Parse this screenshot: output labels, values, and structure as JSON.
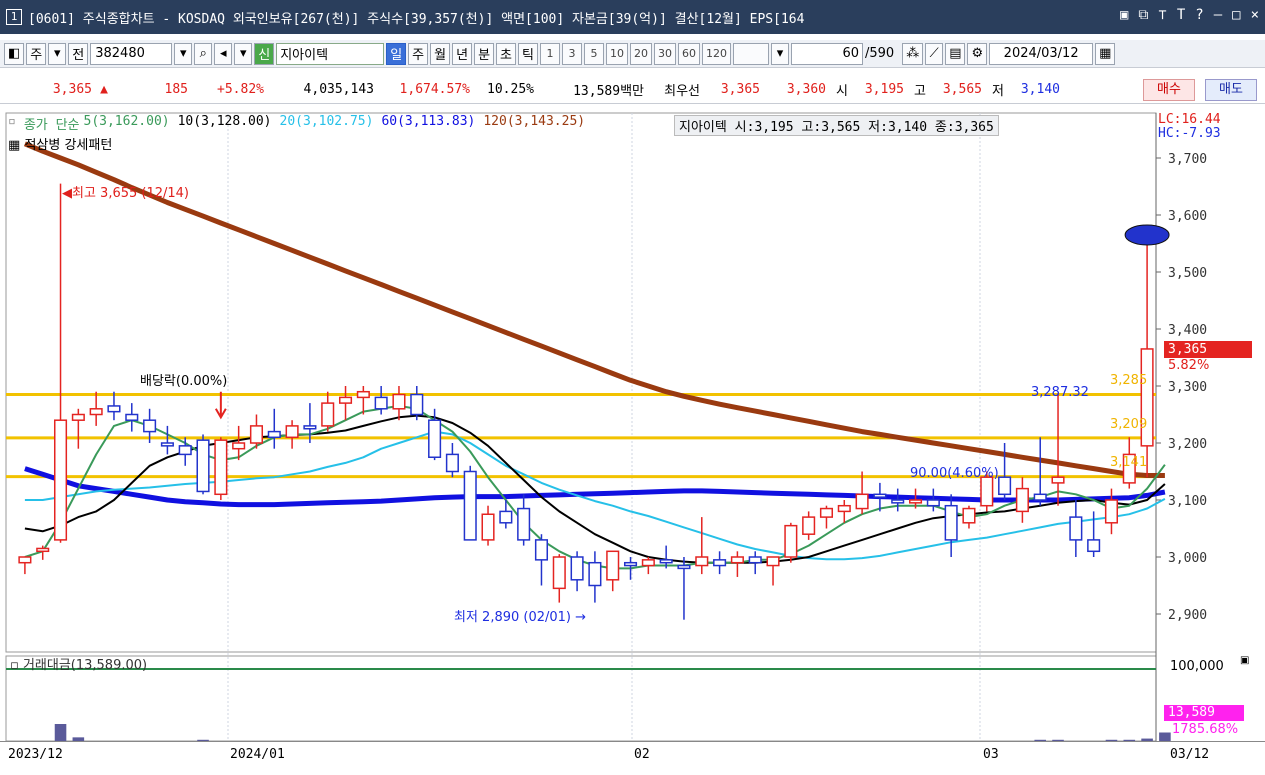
{
  "window": {
    "number": "1",
    "title": "[0601] 주식종합차트 - KOSDAQ 외국인보유[267(천)] 주식수[39,357(천)] 액면[100] 자본금[39(억)] 결산[12월] EPS[164",
    "icons": [
      "window-icon",
      "popout-icon",
      "pin-icon",
      "font-icon",
      "help-icon",
      "minimize-icon",
      "maximize-icon",
      "close-icon"
    ]
  },
  "toolbar": {
    "mode": "주",
    "prefix": "전",
    "code": "382480",
    "name_badge": "신",
    "name": "지아이텍",
    "periods": [
      "일",
      "주",
      "월",
      "년",
      "분",
      "초",
      "틱"
    ],
    "selected_period": "일",
    "intervals": [
      "1",
      "3",
      "5",
      "10",
      "20",
      "30",
      "60",
      "120"
    ],
    "count": "60",
    "total": "/590",
    "date": "2024/03/12"
  },
  "info": {
    "price": "3,365",
    "change_arrow": "▲",
    "change": "185",
    "change_pct": "+5.82%",
    "volume": "4,035,143",
    "volume_ratio": "1,674.57%",
    "turnover": "10.25%",
    "amount": "13,589백만",
    "best_label": "최우선",
    "ask": "3,365",
    "bid": "3,360",
    "open_label": "시",
    "open": "3,195",
    "high_label": "고",
    "high": "3,565",
    "low_label": "저",
    "low": "3,140",
    "buy_label": "매수",
    "sell_label": "매도"
  },
  "legend": {
    "main": "종가 단순",
    "ma5": "5(3,162.00)",
    "ma10": "10(3,128.00)",
    "ma20": "20(3,102.75)",
    "ma60": "60(3,113.83)",
    "ma120": "120(3,143.25)",
    "pattern": "적삼병 강세패턴",
    "stock_info": "지아이텍 시:3,195 고:3,565 저:3,140 종:3,365",
    "lc": "LC:16.44",
    "hc": "HC:-7.93",
    "colors": {
      "ma5": "#3a9a5a",
      "ma10": "#000000",
      "ma20": "#26c0e8",
      "ma60": "#1010e0",
      "ma120": "#9a3a10"
    }
  },
  "annotations": {
    "high": "최고 3,655 (12/14)",
    "low": "최저 2,890 (02/01)",
    "dividend": "배당락(0.00%)",
    "level1": "3,287.32",
    "level2": "90.00(4.60%)",
    "hline1": "3,285",
    "hline2": "3,209",
    "hline3": "3,141",
    "last_price": "3,365",
    "last_pct": "5.82%"
  },
  "price_axis": [
    "3,700",
    "3,600",
    "3,500",
    "3,400",
    "3,300",
    "3,200",
    "3,100",
    "3,000",
    "2,900"
  ],
  "volume_panel": {
    "label": "거래대금(13,589.00)",
    "axis_top": "100,000",
    "value": "13,589",
    "pct": "1785.68%"
  },
  "date_axis": {
    "labels": [
      "2023/12",
      "2024/01",
      "02",
      "03"
    ],
    "current": "03/12"
  },
  "chart_data": {
    "type": "candlestick",
    "ylim": [
      2850,
      3740
    ],
    "candles": [
      {
        "o": 2990,
        "h": 3000,
        "l": 2970,
        "c": 3000
      },
      {
        "o": 3010,
        "h": 3020,
        "l": 2995,
        "c": 3015
      },
      {
        "o": 3030,
        "h": 3655,
        "l": 3025,
        "c": 3240
      },
      {
        "o": 3240,
        "h": 3260,
        "l": 3190,
        "c": 3250
      },
      {
        "o": 3250,
        "h": 3290,
        "l": 3230,
        "c": 3260
      },
      {
        "o": 3265,
        "h": 3290,
        "l": 3240,
        "c": 3255
      },
      {
        "o": 3250,
        "h": 3270,
        "l": 3220,
        "c": 3240
      },
      {
        "o": 3240,
        "h": 3260,
        "l": 3200,
        "c": 3220
      },
      {
        "o": 3200,
        "h": 3230,
        "l": 3180,
        "c": 3195
      },
      {
        "o": 3195,
        "h": 3210,
        "l": 3160,
        "c": 3180
      },
      {
        "o": 3205,
        "h": 3215,
        "l": 3110,
        "c": 3115
      },
      {
        "o": 3110,
        "h": 3210,
        "l": 3100,
        "c": 3205
      },
      {
        "o": 3190,
        "h": 3230,
        "l": 3170,
        "c": 3200
      },
      {
        "o": 3200,
        "h": 3250,
        "l": 3190,
        "c": 3230
      },
      {
        "o": 3220,
        "h": 3260,
        "l": 3190,
        "c": 3210
      },
      {
        "o": 3210,
        "h": 3240,
        "l": 3190,
        "c": 3230
      },
      {
        "o": 3230,
        "h": 3270,
        "l": 3200,
        "c": 3225
      },
      {
        "o": 3230,
        "h": 3290,
        "l": 3220,
        "c": 3270
      },
      {
        "o": 3270,
        "h": 3300,
        "l": 3240,
        "c": 3280
      },
      {
        "o": 3280,
        "h": 3300,
        "l": 3250,
        "c": 3290
      },
      {
        "o": 3280,
        "h": 3300,
        "l": 3250,
        "c": 3260
      },
      {
        "o": 3260,
        "h": 3300,
        "l": 3240,
        "c": 3285
      },
      {
        "o": 3285,
        "h": 3300,
        "l": 3240,
        "c": 3250
      },
      {
        "o": 3240,
        "h": 3260,
        "l": 3170,
        "c": 3175
      },
      {
        "o": 3180,
        "h": 3200,
        "l": 3140,
        "c": 3150
      },
      {
        "o": 3150,
        "h": 3160,
        "l": 3030,
        "c": 3030
      },
      {
        "o": 3030,
        "h": 3090,
        "l": 3020,
        "c": 3075
      },
      {
        "o": 3080,
        "h": 3100,
        "l": 3050,
        "c": 3060
      },
      {
        "o": 3085,
        "h": 3110,
        "l": 3020,
        "c": 3030
      },
      {
        "o": 3030,
        "h": 3040,
        "l": 2950,
        "c": 2995
      },
      {
        "o": 2945,
        "h": 3005,
        "l": 2920,
        "c": 3000
      },
      {
        "o": 3000,
        "h": 3010,
        "l": 2940,
        "c": 2960
      },
      {
        "o": 2990,
        "h": 3010,
        "l": 2920,
        "c": 2950
      },
      {
        "o": 2960,
        "h": 3010,
        "l": 2940,
        "c": 3010
      },
      {
        "o": 2990,
        "h": 3000,
        "l": 2960,
        "c": 2985
      },
      {
        "o": 2985,
        "h": 3000,
        "l": 2970,
        "c": 2995
      },
      {
        "o": 2995,
        "h": 3020,
        "l": 2980,
        "c": 2990
      },
      {
        "o": 2985,
        "h": 3000,
        "l": 2890,
        "c": 2980
      },
      {
        "o": 2985,
        "h": 3070,
        "l": 2970,
        "c": 3000
      },
      {
        "o": 2995,
        "h": 3010,
        "l": 2970,
        "c": 2985
      },
      {
        "o": 2990,
        "h": 3010,
        "l": 2965,
        "c": 3000
      },
      {
        "o": 3000,
        "h": 3010,
        "l": 2970,
        "c": 2990
      },
      {
        "o": 2985,
        "h": 3000,
        "l": 2950,
        "c": 3000
      },
      {
        "o": 3000,
        "h": 3060,
        "l": 2990,
        "c": 3055
      },
      {
        "o": 3040,
        "h": 3080,
        "l": 3030,
        "c": 3070
      },
      {
        "o": 3070,
        "h": 3090,
        "l": 3050,
        "c": 3085
      },
      {
        "o": 3080,
        "h": 3100,
        "l": 3060,
        "c": 3090
      },
      {
        "o": 3085,
        "h": 3150,
        "l": 3075,
        "c": 3110
      },
      {
        "o": 3110,
        "h": 3130,
        "l": 3080,
        "c": 3105
      },
      {
        "o": 3100,
        "h": 3120,
        "l": 3080,
        "c": 3095
      },
      {
        "o": 3095,
        "h": 3120,
        "l": 3085,
        "c": 3100
      },
      {
        "o": 3100,
        "h": 3120,
        "l": 3080,
        "c": 3090
      },
      {
        "o": 3090,
        "h": 3110,
        "l": 3000,
        "c": 3030
      },
      {
        "o": 3060,
        "h": 3090,
        "l": 3050,
        "c": 3085
      },
      {
        "o": 3090,
        "h": 3150,
        "l": 3080,
        "c": 3140
      },
      {
        "o": 3140,
        "h": 3200,
        "l": 3100,
        "c": 3110
      },
      {
        "o": 3080,
        "h": 3140,
        "l": 3060,
        "c": 3120
      },
      {
        "o": 3110,
        "h": 3210,
        "l": 3090,
        "c": 3100
      },
      {
        "o": 3130,
        "h": 3287,
        "l": 3090,
        "c": 3140
      },
      {
        "o": 3070,
        "h": 3100,
        "l": 3000,
        "c": 3030
      },
      {
        "o": 3030,
        "h": 3080,
        "l": 3000,
        "c": 3010
      },
      {
        "o": 3060,
        "h": 3120,
        "l": 3040,
        "c": 3100
      },
      {
        "o": 3130,
        "h": 3210,
        "l": 3120,
        "c": 3180
      },
      {
        "o": 3195,
        "h": 3565,
        "l": 3140,
        "c": 3365
      }
    ],
    "ma5": [
      3000,
      3010,
      3060,
      3120,
      3180,
      3230,
      3240,
      3230,
      3215,
      3200,
      3180,
      3170,
      3175,
      3195,
      3210,
      3215,
      3215,
      3225,
      3240,
      3255,
      3260,
      3265,
      3260,
      3240,
      3220,
      3185,
      3140,
      3100,
      3060,
      3030,
      3010,
      2995,
      2985,
      2980,
      2980,
      2985,
      2985,
      2985,
      2990,
      2990,
      2990,
      2995,
      2995,
      3005,
      3020,
      3040,
      3060,
      3075,
      3085,
      3090,
      3090,
      3090,
      3080,
      3070,
      3075,
      3090,
      3100,
      3105,
      3115,
      3110,
      3100,
      3085,
      3090,
      3120,
      3162
    ],
    "ma10": [
      3050,
      3045,
      3055,
      3070,
      3080,
      3100,
      3130,
      3160,
      3175,
      3185,
      3195,
      3200,
      3205,
      3210,
      3212,
      3214,
      3215,
      3218,
      3222,
      3230,
      3238,
      3245,
      3248,
      3245,
      3235,
      3218,
      3195,
      3165,
      3135,
      3105,
      3080,
      3060,
      3040,
      3025,
      3010,
      3000,
      2995,
      2992,
      2990,
      2990,
      2990,
      2990,
      2992,
      2995,
      3000,
      3010,
      3020,
      3030,
      3040,
      3050,
      3060,
      3068,
      3072,
      3075,
      3078,
      3080,
      3085,
      3090,
      3095,
      3098,
      3100,
      3095,
      3092,
      3100,
      3128
    ],
    "ma20": [
      3100,
      3100,
      3105,
      3110,
      3115,
      3118,
      3120,
      3122,
      3125,
      3128,
      3130,
      3132,
      3135,
      3138,
      3140,
      3145,
      3150,
      3158,
      3165,
      3175,
      3190,
      3200,
      3210,
      3220,
      3215,
      3200,
      3180,
      3160,
      3145,
      3130,
      3118,
      3108,
      3098,
      3090,
      3080,
      3072,
      3062,
      3052,
      3042,
      3032,
      3022,
      3014,
      3008,
      3002,
      2998,
      2996,
      2996,
      2998,
      3002,
      3008,
      3014,
      3020,
      3026,
      3030,
      3034,
      3040,
      3046,
      3052,
      3058,
      3062,
      3066,
      3070,
      3075,
      3085,
      3102
    ],
    "ma60": [
      3155,
      3145,
      3135,
      3125,
      3120,
      3115,
      3110,
      3105,
      3100,
      3097,
      3095,
      3093,
      3092,
      3092,
      3092,
      3093,
      3094,
      3095,
      3096,
      3097,
      3098,
      3100,
      3102,
      3104,
      3105,
      3106,
      3106,
      3106,
      3107,
      3108,
      3109,
      3110,
      3111,
      3112,
      3113,
      3114,
      3115,
      3116,
      3116,
      3115,
      3114,
      3113,
      3112,
      3111,
      3110,
      3109,
      3108,
      3107,
      3106,
      3105,
      3104,
      3103,
      3102,
      3101,
      3100,
      3100,
      3100,
      3100,
      3100,
      3101,
      3102,
      3103,
      3104,
      3108,
      3114
    ],
    "ma120": [
      3725,
      3712,
      3700,
      3688,
      3675,
      3662,
      3648,
      3635,
      3622,
      3610,
      3598,
      3586,
      3574,
      3562,
      3550,
      3538,
      3526,
      3514,
      3502,
      3490,
      3478,
      3466,
      3454,
      3442,
      3430,
      3418,
      3406,
      3394,
      3382,
      3370,
      3358,
      3346,
      3334,
      3322,
      3310,
      3300,
      3290,
      3282,
      3275,
      3268,
      3262,
      3256,
      3250,
      3244,
      3238,
      3232,
      3226,
      3220,
      3215,
      3210,
      3205,
      3200,
      3195,
      3190,
      3185,
      3180,
      3175,
      3170,
      3165,
      3160,
      3155,
      3150,
      3145,
      3143,
      3143
    ],
    "hlines": [
      3285,
      3209,
      3141
    ],
    "volume": [
      0,
      0,
      14,
      3,
      0,
      0,
      0,
      0,
      0,
      0,
      1,
      0,
      0,
      0,
      0,
      0,
      0,
      0,
      0,
      0,
      0,
      0,
      0,
      0,
      0,
      0,
      0,
      0,
      0,
      0,
      0,
      0,
      0,
      0,
      0,
      0,
      0,
      0,
      0,
      0,
      0,
      0,
      0,
      0,
      0,
      0,
      0,
      0,
      0,
      0,
      0,
      0,
      0,
      0,
      0,
      0,
      0,
      1,
      1,
      0,
      0,
      1,
      1,
      2,
      7
    ]
  }
}
